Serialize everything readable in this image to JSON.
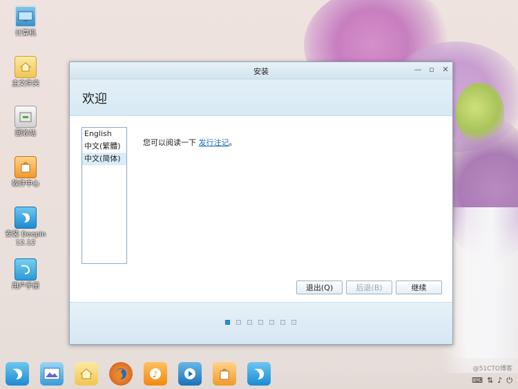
{
  "desktop": {
    "icons": [
      {
        "label": "计算机",
        "icon": "computer-icon"
      },
      {
        "label": "主文件夹",
        "icon": "folder-icon"
      },
      {
        "label": "回收站",
        "icon": "trash-icon"
      },
      {
        "label": "软件中心",
        "icon": "software-center-icon"
      },
      {
        "label": "安装 Deepin 12.12",
        "icon": "deepin-installer-icon"
      },
      {
        "label": "用户手册",
        "icon": "user-manual-icon"
      }
    ]
  },
  "window": {
    "title": "安装",
    "header_title": "欢迎",
    "languages": [
      "English",
      "中文(繁體)",
      "中文(简体)"
    ],
    "selected_language": "中文(简体)",
    "release_text": "您可以阅读一下",
    "release_link": "发行注记",
    "release_suffix": "。",
    "buttons": {
      "quit": "退出(Q)",
      "back": "后退(B)",
      "continue": "继续"
    },
    "progress": {
      "total_steps": 7,
      "current_step": 1
    }
  },
  "dock": {
    "items": [
      "deepin-icon",
      "image-viewer-icon",
      "folder-icon",
      "firefox-icon",
      "music-player-icon",
      "video-player-icon",
      "software-center-icon",
      "deepin-installer-icon"
    ]
  },
  "watermark": "@51CTO博客"
}
